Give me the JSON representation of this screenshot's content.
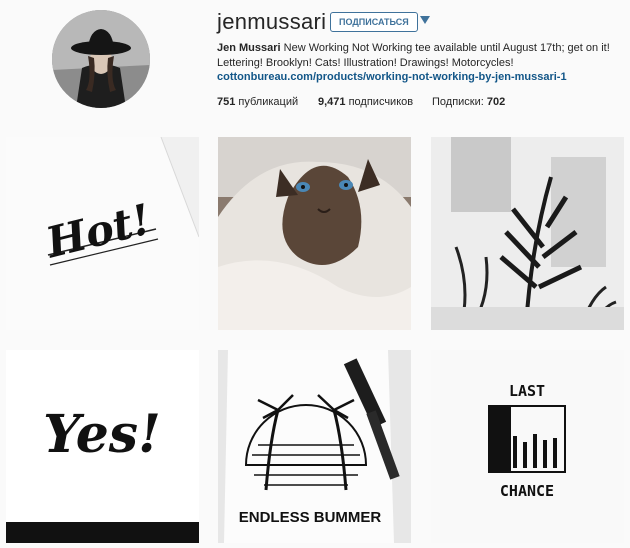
{
  "profile": {
    "username": "jenmussari",
    "follow_label": "ПОДПИСАТЬСЯ",
    "full_name": "Jen Mussari",
    "bio_text": " New Working Not Working tee available until August 17th; get on it! Lettering! Brooklyn! Cats! Illustration! Drawings! Motorcycles!",
    "link": "cottonbureau.com/products/working-not-working-by-jen-mussari-1"
  },
  "stats": {
    "posts_count": "751",
    "posts_label": " публикаций",
    "followers_count": "9,471",
    "followers_label": " подписчиков",
    "following_label": "Подписки: ",
    "following_count": "702"
  },
  "posts": [
    {
      "text": "Hot!"
    },
    {
      "text": ""
    },
    {
      "text": ""
    },
    {
      "text": "Yes!"
    },
    {
      "text": "ENDLESS BUMMER"
    },
    {
      "text_top": "LAST",
      "text_bottom": "CHANCE"
    }
  ],
  "colors": {
    "link": "#125688",
    "follow_border": "#3f729b",
    "background": "#fafafa"
  },
  "icons": [
    "dropdown-arrow-icon"
  ]
}
